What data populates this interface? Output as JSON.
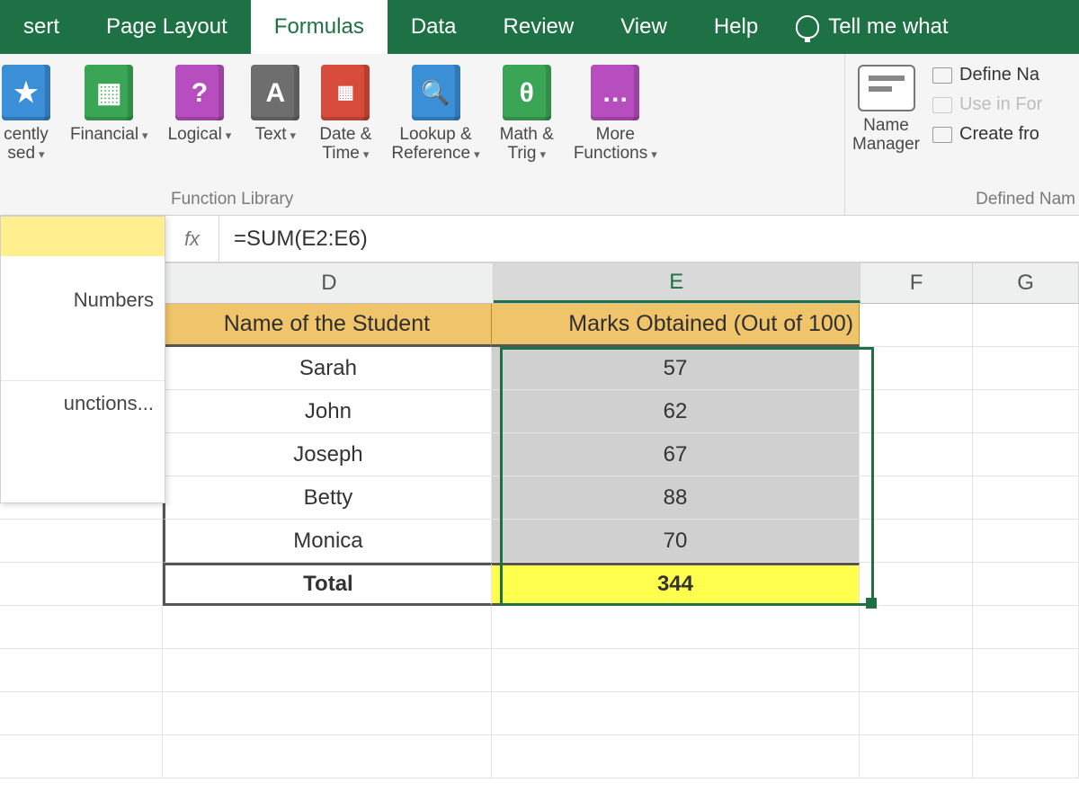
{
  "tabs": {
    "insert": "sert",
    "page_layout": "Page Layout",
    "formulas": "Formulas",
    "data": "Data",
    "review": "Review",
    "view": "View",
    "help": "Help",
    "tellme": "Tell me what"
  },
  "ribbon": {
    "recently": "cently\nsed",
    "financial": "Financial",
    "logical": "Logical",
    "text": "Text",
    "datetime": "Date &\nTime",
    "lookup": "Lookup &\nReference",
    "math": "Math &\nTrig",
    "more": "More\nFunctions",
    "group_label": "Function Library",
    "name_manager": "Name\nManager",
    "define_name": "Define Na",
    "use_in_formula": "Use in For",
    "create_from": "Create fro",
    "right_group_label": "Defined Nam"
  },
  "icon_glyph": {
    "recently": "★",
    "financial": "",
    "logical": "?",
    "text": "A",
    "datetime": "",
    "lookup": "",
    "math": "θ",
    "more": "…"
  },
  "colors": {
    "recently": "#3a8fd6",
    "financial": "#3aa655",
    "logical": "#b74ec0",
    "text": "#6e6e6e",
    "datetime": "#d64b3a",
    "lookup": "#3a8fd6",
    "math": "#3aa655",
    "more": "#b74ec0"
  },
  "autosum_menu": {
    "item1": "",
    "item2": "Numbers",
    "item3": "unctions..."
  },
  "formula_bar": {
    "fx": "fx",
    "value": "=SUM(E2:E6)"
  },
  "columns": {
    "D": "D",
    "E": "E",
    "F": "F",
    "G": "G"
  },
  "table": {
    "header_name": "Name of the Student",
    "header_marks": "Marks Obtained (Out of 100)",
    "rows": [
      {
        "name": "Sarah",
        "marks": "57"
      },
      {
        "name": "John",
        "marks": "62"
      },
      {
        "name": "Joseph",
        "marks": "67"
      },
      {
        "name": "Betty",
        "marks": "88"
      },
      {
        "name": "Monica",
        "marks": "70"
      }
    ],
    "total_label": "Total",
    "total_value": "344"
  }
}
